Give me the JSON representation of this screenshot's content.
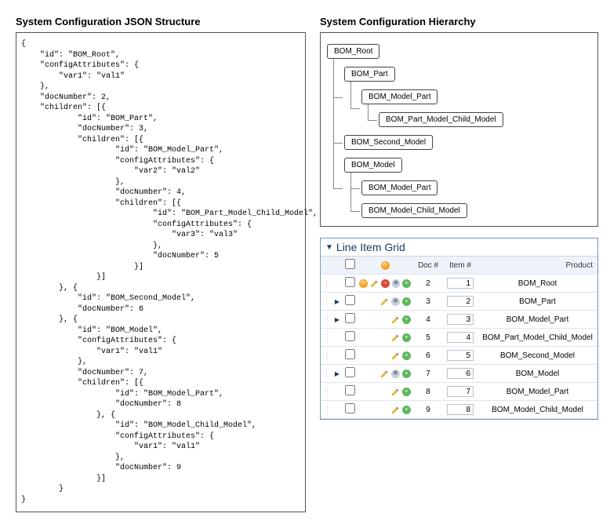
{
  "left": {
    "title": "System Configuration JSON Structure",
    "json_text": "{\n    \"id\": \"BOM_Root\",\n    \"configAttributes\": {\n        \"var1\": \"val1\"\n    },\n    \"docNumber\": 2,\n    \"children\": [{\n            \"id\": \"BOM_Part\",\n            \"docNumber\": 3,\n            \"children\": [{\n                    \"id\": \"BOM_Model_Part\",\n                    \"configAttributes\": {\n                        \"var2\": \"val2\"\n                    },\n                    \"docNumber\": 4,\n                    \"children\": [{\n                            \"id\": \"BOM_Part_Model_Child_Model\",\n                            \"configAttributes\": {\n                                \"var3\": \"val3\"\n                            },\n                            \"docNumber\": 5\n                        }]\n                }]\n        }, {\n            \"id\": \"BOM_Second_Model\",\n            \"docNumber\": 6\n        }, {\n            \"id\": \"BOM_Model\",\n            \"configAttributes\": {\n                \"var1\": \"val1\"\n            },\n            \"docNumber\": 7,\n            \"children\": [{\n                    \"id\": \"BOM_Model_Part\",\n                    \"docNumber\": 8\n                }, {\n                    \"id\": \"BOM_Model_Child_Model\",\n                    \"configAttributes\": {\n                        \"var1\": \"val1\"\n                    },\n                    \"docNumber\": 9\n                }]\n        }\n}"
  },
  "hierarchy": {
    "title": "System Configuration Hierarchy",
    "tree": {
      "root": "BOM_Root",
      "n_part": "BOM_Part",
      "n_model_part1": "BOM_Model_Part",
      "n_part_model_child": "BOM_Part_Model_Child_Model",
      "n_second": "BOM_Second_Model",
      "n_model": "BOM_Model",
      "n_model_part2": "BOM_Model_Part",
      "n_model_child": "BOM_Model_Child_Model"
    }
  },
  "grid": {
    "title": "Line Item Grid",
    "headers": {
      "doc": "Doc #",
      "item": "Item #",
      "product": "Product"
    },
    "rows": [
      {
        "toggle": "",
        "icons": [
          "docs",
          "edit",
          "minus",
          "gear",
          "plus"
        ],
        "doc": "2",
        "item": "1",
        "product": "BOM_Root"
      },
      {
        "toggle": "▶",
        "icons": [
          "edit",
          "gear",
          "plus"
        ],
        "doc": "3",
        "item": "2",
        "product": "BOM_Part"
      },
      {
        "toggle": "▶",
        "icons": [
          "edit",
          "plus"
        ],
        "doc": "4",
        "item": "3",
        "product": "BOM_Model_Part"
      },
      {
        "toggle": "",
        "icons": [
          "edit",
          "plus"
        ],
        "doc": "5",
        "item": "4",
        "product": "BOM_Part_Model_Child_Model"
      },
      {
        "toggle": "",
        "icons": [
          "edit",
          "plus"
        ],
        "doc": "6",
        "item": "5",
        "product": "BOM_Second_Model"
      },
      {
        "toggle": "▶",
        "icons": [
          "edit",
          "gear",
          "plus"
        ],
        "doc": "7",
        "item": "6",
        "product": "BOM_Model"
      },
      {
        "toggle": "",
        "icons": [
          "edit",
          "plus"
        ],
        "doc": "8",
        "item": "7",
        "product": "BOM_Model_Part"
      },
      {
        "toggle": "",
        "icons": [
          "edit",
          "plus"
        ],
        "doc": "9",
        "item": "8",
        "product": "BOM_Model_Child_Model"
      }
    ]
  }
}
